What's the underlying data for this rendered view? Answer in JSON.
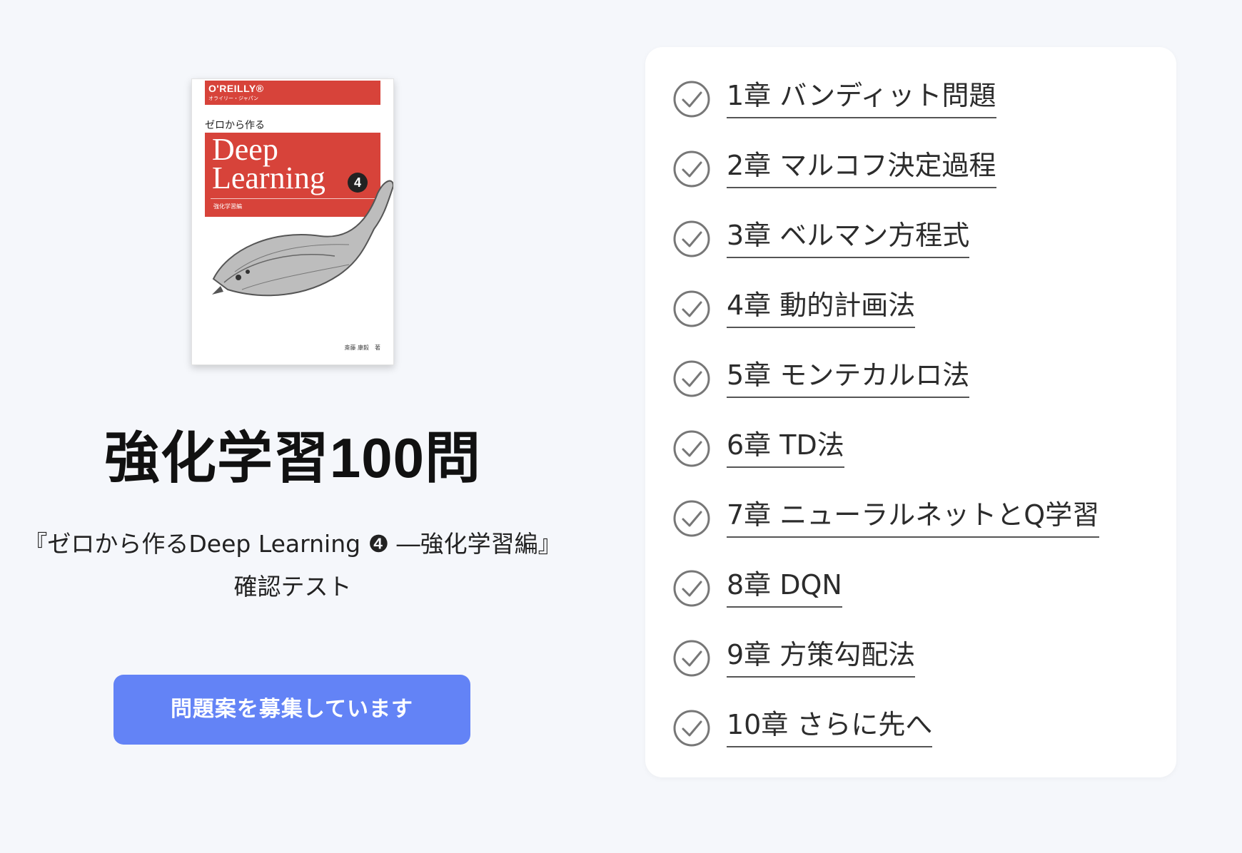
{
  "book": {
    "publisher": "O'REILLY®",
    "publisher_sub": "オライリー・ジャパン",
    "kicker": "ゼロから作る",
    "title_line1": "Deep",
    "title_line2": "Learning",
    "volume": "4",
    "subtitle": "強化学習編",
    "author": "斎藤 康毅　著"
  },
  "header": {
    "title": "強化学習100問",
    "subtitle_line1": "『ゼロから作るDeep Learning ❹ ―強化学習編』",
    "subtitle_line2": "確認テスト"
  },
  "cta": {
    "label": "問題案を募集しています"
  },
  "chapters": [
    {
      "label": "1章 バンディット問題"
    },
    {
      "label": "2章 マルコフ決定過程"
    },
    {
      "label": "3章 ベルマン方程式"
    },
    {
      "label": "4章 動的計画法"
    },
    {
      "label": "5章 モンテカルロ法"
    },
    {
      "label": "6章 TD法"
    },
    {
      "label": "7章 ニューラルネットとQ学習"
    },
    {
      "label": "8章 DQN"
    },
    {
      "label": "9章 方策勾配法"
    },
    {
      "label": "10章 さらに先へ"
    }
  ],
  "colors": {
    "background": "#f5f7fb",
    "accent": "#6383f6",
    "cover_red": "#d7433a",
    "check": "#777777"
  },
  "icons": {
    "chapter_status": "check-circle-icon"
  }
}
